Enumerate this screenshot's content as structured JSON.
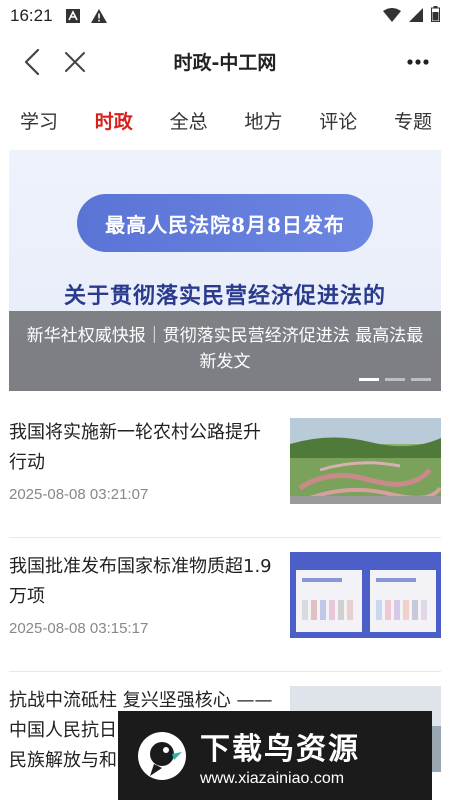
{
  "status_bar": {
    "time": "16:21",
    "icons": [
      "font-a-icon",
      "alert-icon",
      "wifi-icon",
      "signal-icon",
      "battery-icon"
    ]
  },
  "nav": {
    "title": "时政-中工网",
    "back_icon": "back-icon",
    "close_icon": "close-icon",
    "more_icon": "more-icon"
  },
  "tabs": [
    {
      "label": "学习",
      "active": false
    },
    {
      "label": "时政",
      "active": true
    },
    {
      "label": "全总",
      "active": false
    },
    {
      "label": "地方",
      "active": false
    },
    {
      "label": "评论",
      "active": false
    },
    {
      "label": "专题",
      "active": false
    }
  ],
  "banner": {
    "pill_text": "最高人民法院8月8日发布",
    "headline_text": "关于贯彻落实民营经济促进法的",
    "caption": "新华社权威快报｜贯彻落实民营经济促进法 最高法最新发文",
    "slides_total": 3,
    "active_slide": 1
  },
  "news": [
    {
      "title": "我国将实施新一轮农村公路提升行动",
      "time": "2025-08-08 03:21:07",
      "thumb": "road-photo"
    },
    {
      "title": "我国批准发布国家标准物质超1.9万项",
      "time": "2025-08-08 03:15:17",
      "thumb": "sample-box-photo"
    },
    {
      "title": "抗战中流砥柱 复兴坚强核心 ——中国人民抗日战争纪念馆《为了民族解放与和平》主题展览巡礼",
      "time": "",
      "thumb": "exhibition-photo"
    }
  ],
  "watermark": {
    "brand": "下载鸟资源",
    "url": "www.xiazainiao.com"
  },
  "colors": {
    "accent": "#d8201c",
    "pill": "#5a74d6",
    "headline": "#2a3a8c"
  }
}
